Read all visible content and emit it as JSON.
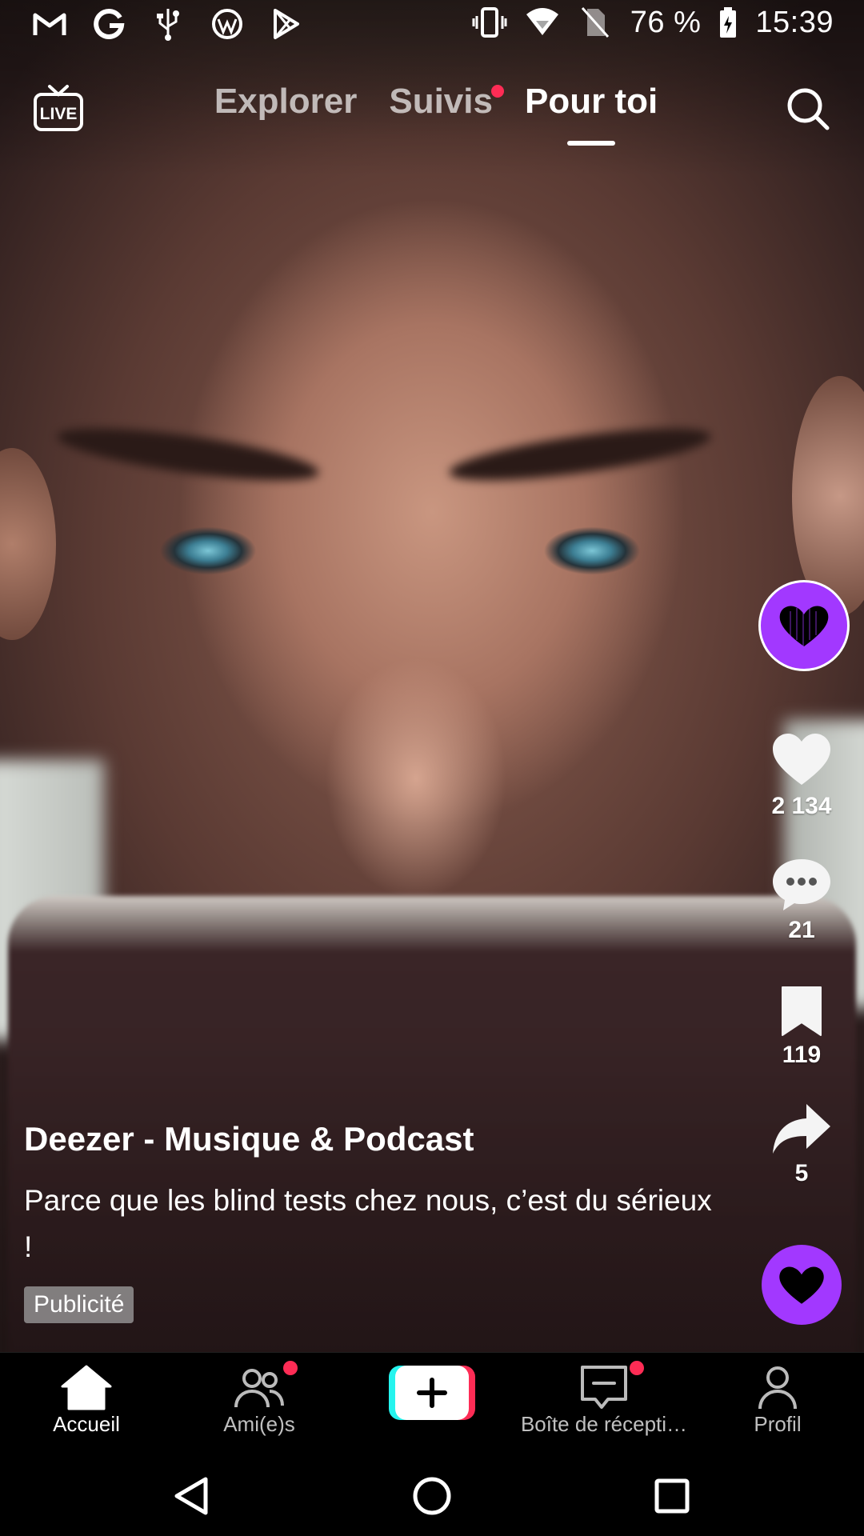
{
  "status_bar": {
    "notification_icons": [
      "gmail-icon",
      "google-icon",
      "usb-icon",
      "wordpress-icon",
      "play-store-icon"
    ],
    "system_icons": [
      "vibrate-icon",
      "wifi-icon",
      "no-sim-icon"
    ],
    "battery": "76 %",
    "time": "15:39"
  },
  "top_nav": {
    "live_label": "LIVE",
    "tabs": [
      {
        "label": "Explorer",
        "active": false
      },
      {
        "label": "Suivis",
        "active": false,
        "has_dot": true
      },
      {
        "label": "Pour toi",
        "active": true
      }
    ]
  },
  "actions": {
    "likes": "2 134",
    "comments": "21",
    "bookmarks": "119",
    "shares": "5"
  },
  "caption": {
    "author": "Deezer - Musique & Podcast",
    "description": "Parce que les blind tests chez nous, c’est du sérieux !",
    "ad_label": "Publicité"
  },
  "bottom_nav": {
    "items": [
      {
        "label": "Accueil",
        "active": true
      },
      {
        "label": "Ami(e)s",
        "has_dot": true
      },
      {
        "label": "",
        "icon": "plus-icon"
      },
      {
        "label": "Boîte de récepti…",
        "has_dot": true
      },
      {
        "label": "Profil"
      }
    ]
  },
  "colors": {
    "accent_red": "#fe2c55",
    "deezer_purple": "#a238ff"
  }
}
